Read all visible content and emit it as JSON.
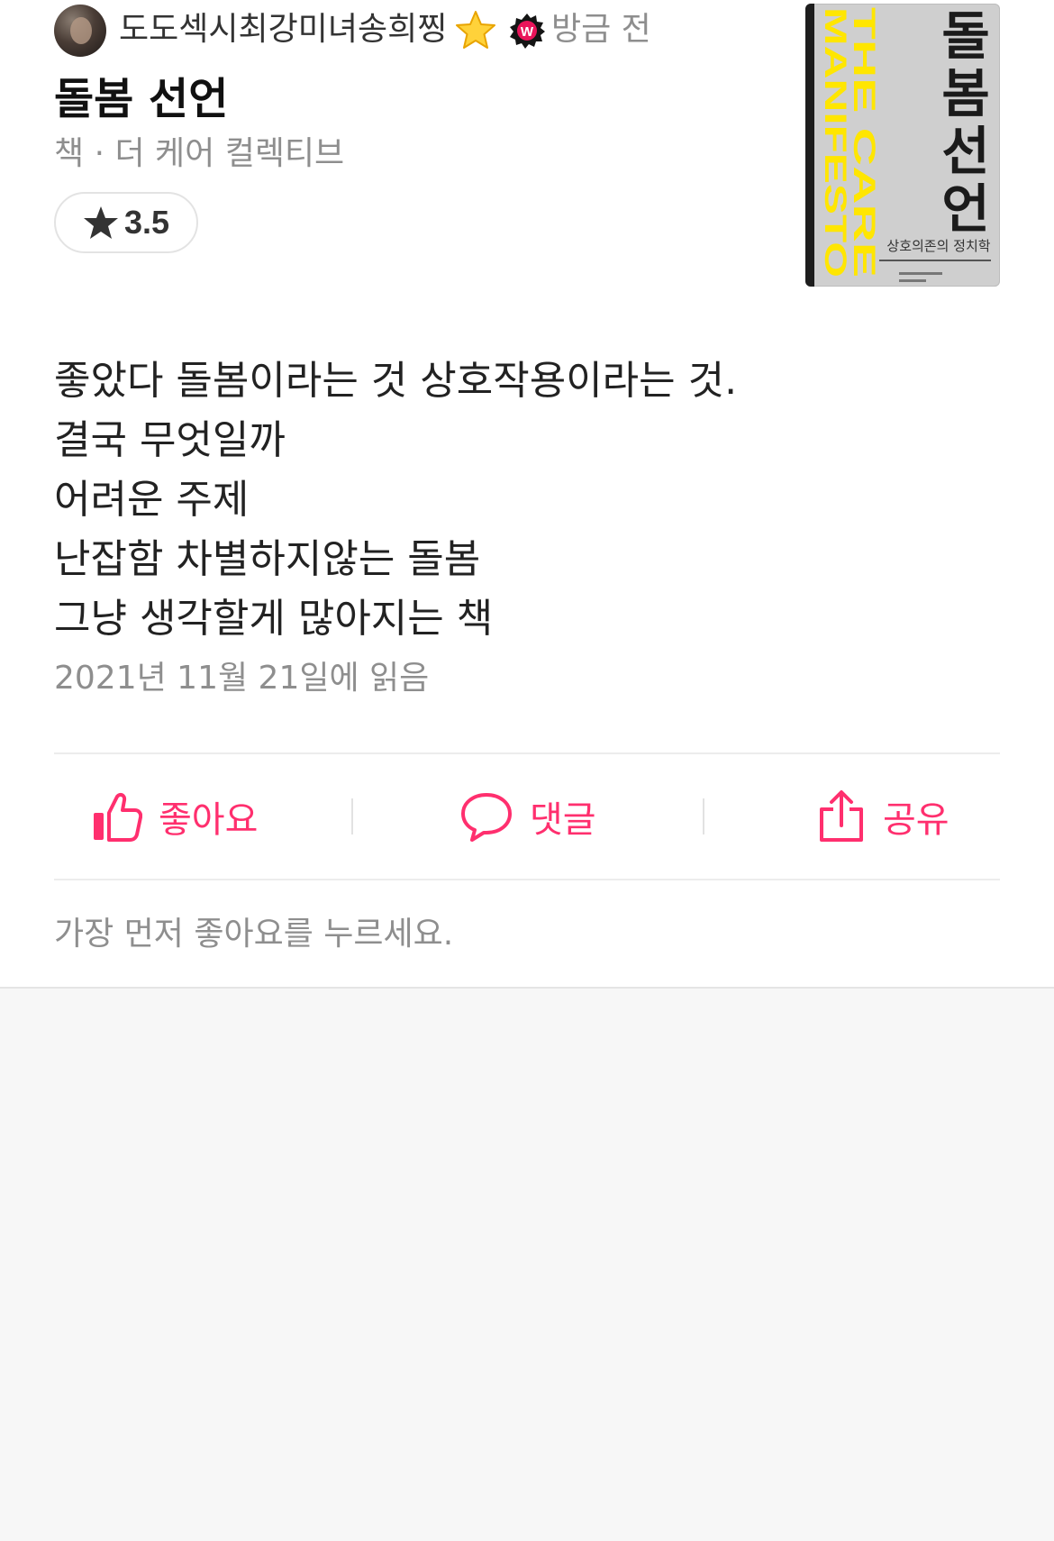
{
  "header": {
    "user_name": "도도섹시최강미녀송희찡",
    "time_ago": "방금 전",
    "star_badge_icon": "star-emoji",
    "watcha_badge_letter": "W",
    "watcha_badge_color": "#e9145a"
  },
  "content": {
    "title": "돌봄 선언",
    "meta": "책 · 더 케어 컬렉티브",
    "rating": "3.5"
  },
  "cover": {
    "title_en_1": "THE CARE",
    "title_en_2": "MANIFESTO",
    "title_ko": "돌봄선언",
    "subtitle": "상호의존의 정치학",
    "accent": "#ffe600"
  },
  "review": {
    "lines": [
      "좋았다 돌봄이라는 것 상호작용이라는 것.",
      "결국 무엇일까",
      "어려운 주제",
      "난잡함 차별하지않는 돌봄",
      "그냥 생각할게 많아지는 책"
    ],
    "read_date": "2021년 11월 21일에 읽음"
  },
  "actions": {
    "like_label": "좋아요",
    "comment_label": "댓글",
    "share_label": "공유",
    "accent": "#ff2f6e"
  },
  "footer": {
    "like_prompt": "가장 먼저 좋아요를 누르세요."
  }
}
